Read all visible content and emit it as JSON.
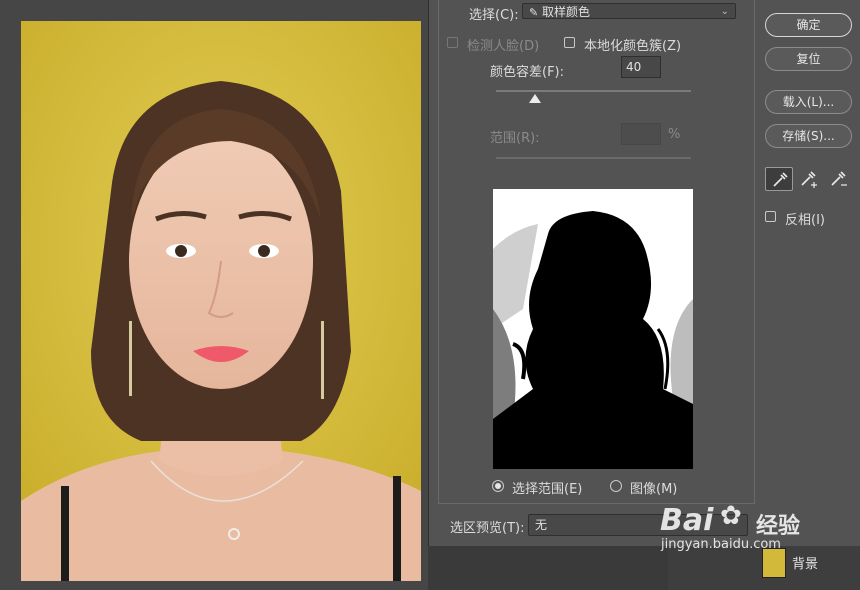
{
  "dialog": {
    "select_label": "选择(C):",
    "select_value": "取样颜色",
    "detect_faces_label": "检测人脸(D)",
    "localized_clusters_label": "本地化颜色簇(Z)",
    "fuzziness_label": "颜色容差(F):",
    "fuzziness_value": "40",
    "fuzziness_fraction": 0.2,
    "range_label": "范围(R):",
    "range_unit": "%",
    "range_value": "",
    "radio_selection": "选择范围(E)",
    "radio_image": "图像(M)",
    "selection_preview_label": "选区预览(T):",
    "selection_preview_value": "无"
  },
  "buttons": {
    "ok": "确定",
    "reset": "复位",
    "load": "载入(L)...",
    "save": "存储(S)..."
  },
  "invert_label": "反相(I)",
  "layers": {
    "background_label": "背景"
  },
  "watermark": {
    "brand": "Bai",
    "brand2": "经验",
    "url": "jingyan.baidu.com"
  }
}
